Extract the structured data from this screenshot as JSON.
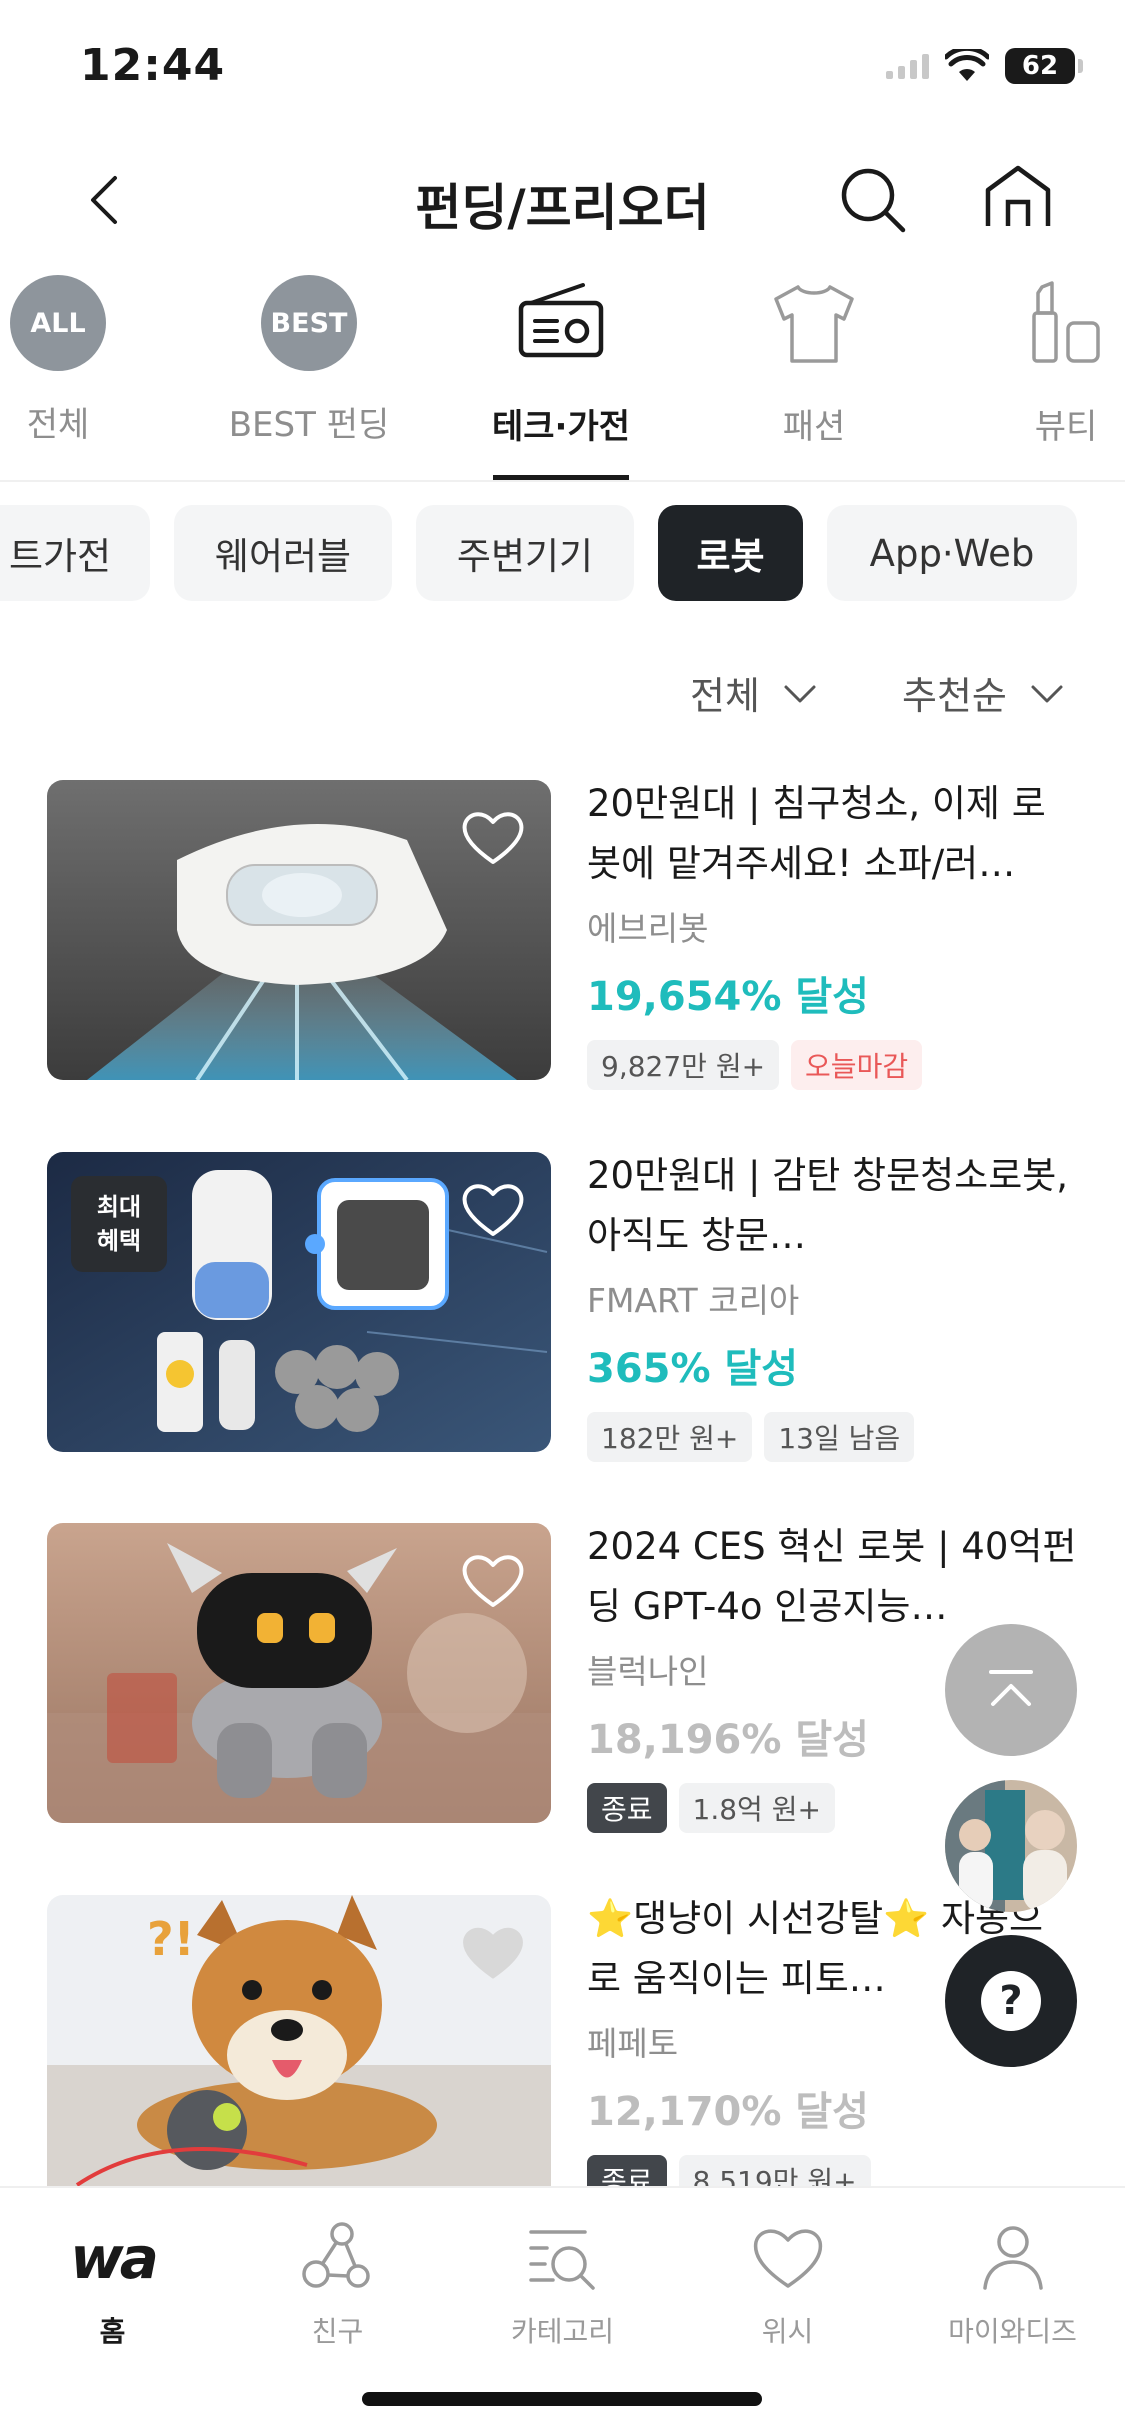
{
  "status": {
    "time": "12:44",
    "battery": "62"
  },
  "header": {
    "title": "펀딩/프리오더"
  },
  "categories": [
    {
      "label": "전체",
      "badge": "ALL",
      "icon": "all-badge"
    },
    {
      "label": "BEST 펀딩",
      "badge": "BEST",
      "icon": "best-badge"
    },
    {
      "label": "테크·가전",
      "icon": "radio-icon",
      "active": true
    },
    {
      "label": "패션",
      "icon": "tshirt-icon"
    },
    {
      "label": "뷰티",
      "icon": "cosmetics-icon"
    }
  ],
  "subcategories": [
    "트가전",
    "웨어러블",
    "주변기기",
    "로봇",
    "App·Web"
  ],
  "subcategory_selected": "로봇",
  "sort": {
    "filter": "전체",
    "order": "추천순"
  },
  "products": [
    {
      "title": "20만원대 | 침구청소, 이제 로봇에 맡겨주세요! 소파/러…",
      "maker": "에브리봇",
      "rate": "19,654% 달성",
      "tags": [
        "9,827만 원+",
        "오늘마감"
      ]
    },
    {
      "title": "20만원대 | 감탄 창문청소로봇, 아직도 창문…",
      "maker": "FMART 코리아",
      "rate": "365% 달성",
      "badge": "최대\n혜택",
      "tags": [
        "182만 원+",
        "13일 남음"
      ]
    },
    {
      "title": "2024 CES 혁신 로봇 | 40억펀딩 GPT-4o 인공지능…",
      "maker": "블럭나인",
      "rate": "18,196% 달성",
      "tags": [
        "종료",
        "1.8억 원+"
      ]
    },
    {
      "title": "⭐댕냥이 시선강탈⭐ 자동으로 움직이는 피토…",
      "maker": "페페토",
      "rate": "12,170% 달성",
      "tags": [
        "종료",
        "8,519만 원+"
      ]
    }
  ],
  "help": {
    "label": "?"
  },
  "bottom_nav": [
    {
      "label": "홈",
      "logo": "wa",
      "icon": "home-logo",
      "active": true
    },
    {
      "label": "친구",
      "icon": "friends-icon"
    },
    {
      "label": "카테고리",
      "icon": "category-icon"
    },
    {
      "label": "위시",
      "icon": "heart-icon"
    },
    {
      "label": "마이와디즈",
      "icon": "profile-icon"
    }
  ],
  "colors": {
    "accent": "#1fbcbc",
    "deadline": "#e95858",
    "chip_active": "#1f2327"
  }
}
